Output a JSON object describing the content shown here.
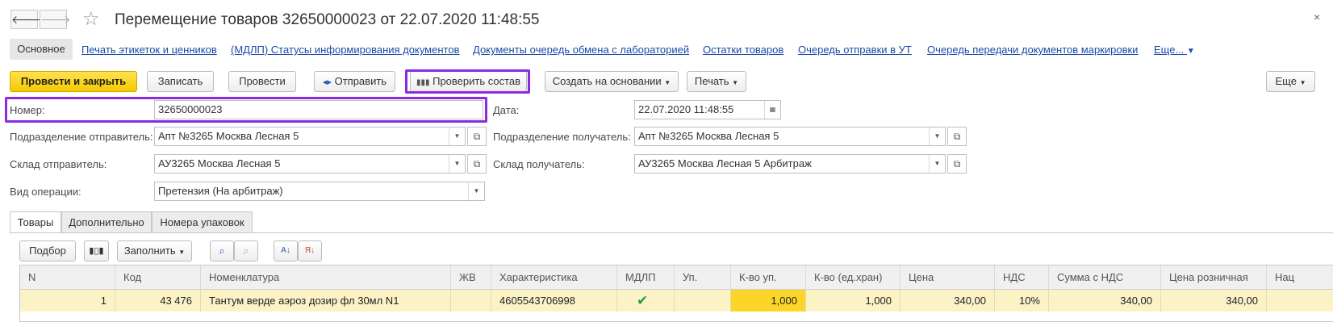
{
  "window": {
    "title": "Перемещение товаров 32650000023 от 22.07.2020 11:48:55",
    "back": "🡐",
    "forward": "🡒",
    "star": "☆",
    "close": "×"
  },
  "nav": {
    "main": "Основное",
    "links": [
      "Печать этикеток и ценников",
      "(МДЛП) Статусы информирования документов",
      "Документы очередь обмена с лабораторией",
      "Остатки товаров",
      "Очередь отправки в УТ",
      "Очередь передачи документов маркировки",
      "Еще..."
    ]
  },
  "toolbar": {
    "post_close": "Провести и закрыть",
    "save": "Записать",
    "post": "Провести",
    "send": "Отправить",
    "check": "Проверить состав",
    "create_based": "Создать на основании",
    "print": "Печать",
    "more": "Еще"
  },
  "form": {
    "number": {
      "label": "Номер:",
      "value": "32650000023"
    },
    "date": {
      "label": "Дата:",
      "value": "22.07.2020 11:48:55"
    },
    "div_sender": {
      "label": "Подразделение отправитель:",
      "value": "Апт №3265 Москва Лесная 5"
    },
    "div_receiver": {
      "label": "Подразделение получатель:",
      "value": "Апт №3265 Москва Лесная 5"
    },
    "wh_sender": {
      "label": "Склад отправитель:",
      "value": "АУ3265 Москва Лесная 5"
    },
    "wh_receiver": {
      "label": "Склад получатель:",
      "value": "АУ3265 Москва Лесная 5 Арбитраж"
    },
    "op_type": {
      "label": "Вид операции:",
      "value": "Претензия (На арбитраж)"
    }
  },
  "tabs": [
    "Товары",
    "Дополнительно",
    "Номера упаковок"
  ],
  "table_toolbar": {
    "select": "Подбор",
    "fill": "Заполнить"
  },
  "table": {
    "headers": [
      "N",
      "Код",
      "Номенклатура",
      "ЖВ",
      "Характеристика",
      "МДЛП",
      "Уп.",
      "К-во уп.",
      "К-во (ед.хран)",
      "Цена",
      "НДС",
      "Сумма с НДС",
      "Цена розничная",
      "Нац"
    ],
    "row": {
      "n": "1",
      "code": "43 476",
      "name": "Тантум верде аэроз дозир фл 30мл N1",
      "zhv": "",
      "char": "4605543706998",
      "mdlp": "✔",
      "up": "",
      "qty_pack": "1,000",
      "qty_unit": "1,000",
      "price": "340,00",
      "vat": "10%",
      "sum_vat": "340,00",
      "retail": "340,00",
      "markup": ""
    }
  },
  "colors": {
    "accent": "#f5c900",
    "highlight": "#8a2be2",
    "link": "#1a4ba7",
    "row": "#fbf3c6"
  }
}
